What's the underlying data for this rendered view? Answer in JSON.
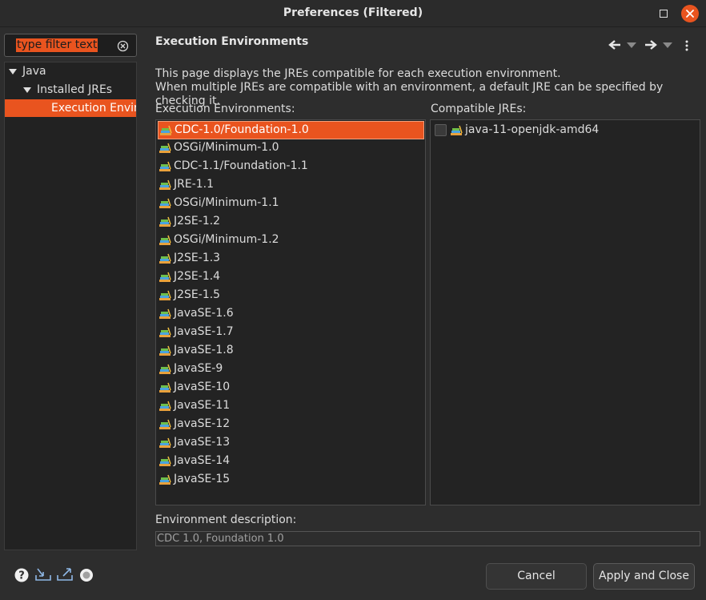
{
  "window": {
    "title": "Preferences (Filtered)"
  },
  "filter": {
    "text": "type filter text"
  },
  "tree": {
    "items": [
      {
        "label": "Java"
      },
      {
        "label": "Installed JREs"
      },
      {
        "label": "Execution Environments"
      }
    ]
  },
  "page": {
    "title": "Execution Environments",
    "description_line1": "This page displays the JREs compatible for each execution environment.",
    "description_line2": "When multiple JREs are compatible with an environment, a default JRE can be specified by checking it."
  },
  "env_list": {
    "label": "Execution Environments:",
    "items": [
      "CDC-1.0/Foundation-1.0",
      "OSGi/Minimum-1.0",
      "CDC-1.1/Foundation-1.1",
      "JRE-1.1",
      "OSGi/Minimum-1.1",
      "J2SE-1.2",
      "OSGi/Minimum-1.2",
      "J2SE-1.3",
      "J2SE-1.4",
      "J2SE-1.5",
      "JavaSE-1.6",
      "JavaSE-1.7",
      "JavaSE-1.8",
      "JavaSE-9",
      "JavaSE-10",
      "JavaSE-11",
      "JavaSE-12",
      "JavaSE-13",
      "JavaSE-14",
      "JavaSE-15"
    ],
    "selected_index": 0
  },
  "jre_list": {
    "label": "Compatible JREs:",
    "items": [
      {
        "label": "java-11-openjdk-amd64",
        "checked": false
      }
    ]
  },
  "environment_description": {
    "label": "Environment description:",
    "value": "CDC 1.0, Foundation 1.0"
  },
  "buttons": {
    "cancel": "Cancel",
    "apply_close": "Apply and Close"
  },
  "colors": {
    "accent": "#e9541f",
    "background": "#2d2d2d",
    "list_background": "#232323"
  },
  "icons": {
    "bottom": [
      "help-icon",
      "import-icon",
      "export-icon",
      "record-icon"
    ],
    "nav": [
      "back-arrow-icon",
      "back-dropdown-icon",
      "forward-arrow-icon",
      "forward-dropdown-icon",
      "view-menu-icon"
    ],
    "list_item": "jre-library-icon"
  }
}
